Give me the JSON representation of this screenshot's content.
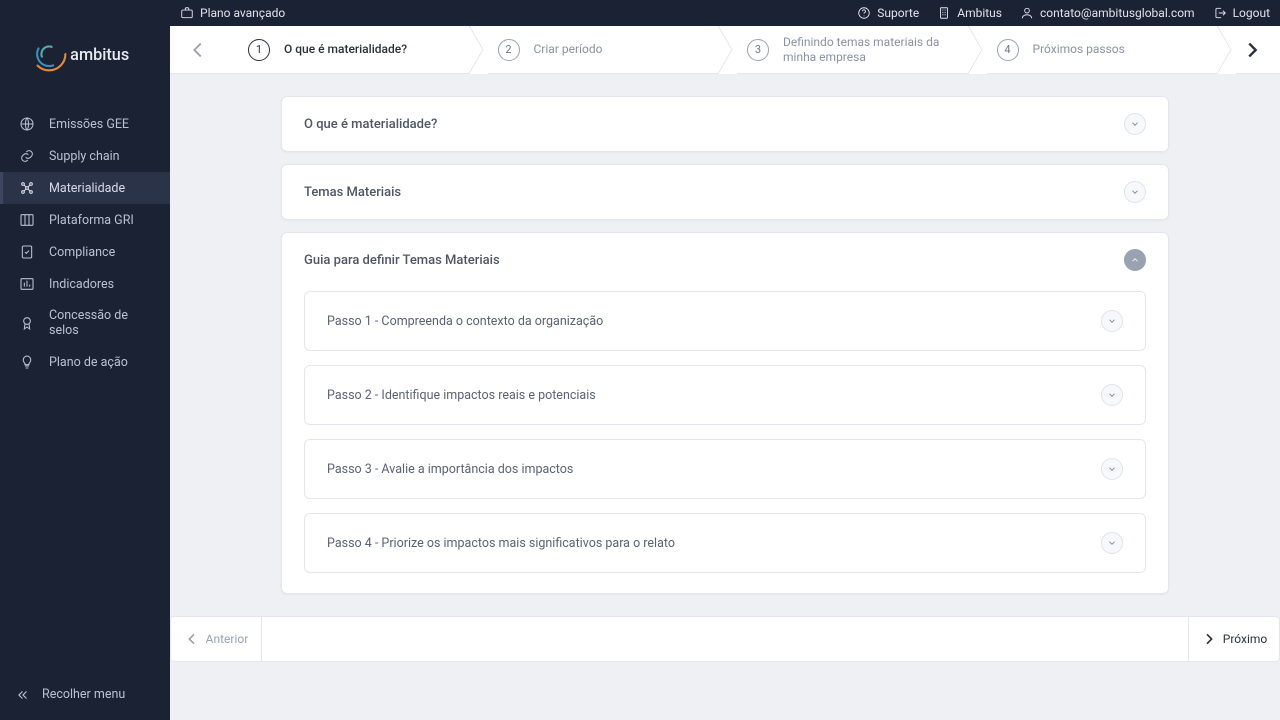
{
  "brand": {
    "name": "ambitus"
  },
  "topbar": {
    "plan_label": "Plano avançado",
    "links": {
      "support": "Suporte",
      "org": "Ambitus",
      "email": "contato@ambitusglobal.com",
      "logout": "Logout"
    }
  },
  "sidebar": {
    "items": [
      {
        "id": "emissions",
        "label": "Emissões GEE"
      },
      {
        "id": "supply",
        "label": "Supply chain"
      },
      {
        "id": "materiality",
        "label": "Materialidade"
      },
      {
        "id": "gri",
        "label": "Plataforma GRI"
      },
      {
        "id": "compliance",
        "label": "Compliance"
      },
      {
        "id": "indicators",
        "label": "Indicadores"
      },
      {
        "id": "seals",
        "label": "Concessão de selos"
      },
      {
        "id": "actionplan",
        "label": "Plano de ação"
      }
    ],
    "active_index": 2,
    "collapse_label": "Recolher menu"
  },
  "stepper": {
    "active_index": 0,
    "steps": [
      {
        "num": "1",
        "label": "O que é materialidade?"
      },
      {
        "num": "2",
        "label": "Criar período"
      },
      {
        "num": "3",
        "label": "Definindo temas materiais da minha empresa"
      },
      {
        "num": "4",
        "label": "Próximos passos"
      }
    ]
  },
  "panels": {
    "p1": {
      "title": "O que é materialidade?",
      "expanded": false
    },
    "p2": {
      "title": "Temas Materiais",
      "expanded": false
    },
    "p3": {
      "title": "Guia para definir Temas Materiais",
      "expanded": true,
      "substeps": [
        "Passo 1 - Compreenda o contexto da organização",
        "Passo 2 - Identifique impactos reais e potenciais",
        "Passo 3 - Avalie a importância dos impactos",
        "Passo 4 - Priorize os impactos mais significativos para o relato"
      ]
    }
  },
  "footer": {
    "prev": "Anterior",
    "next": "Próximo"
  }
}
